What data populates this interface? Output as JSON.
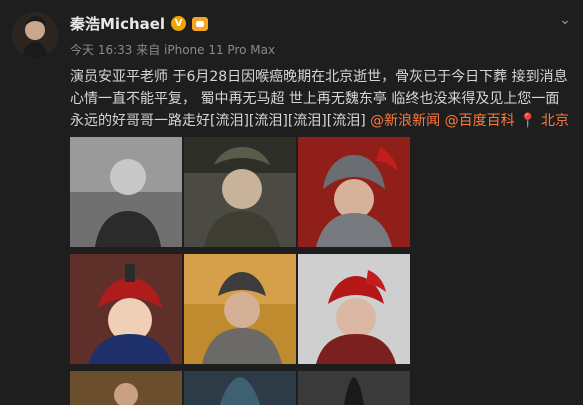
{
  "post": {
    "username": "秦浩Michael",
    "vip_badge": "V",
    "meta": "今天 16:33 来自 iPhone 11 Pro Max",
    "text_main": "演员安亚平老师 于6月28日因喉癌晚期在北京逝世，骨灰已于今日下葬 接到消息心情一直不能平复， 蜀中再无马超 世上再无魏东亭 临终也没来得及见上您一面 永远的好哥哥一路走好[流泪][流泪][流泪][流泪]",
    "link_sina": "@新浪新闻",
    "link_baike": "@百度百科",
    "location": "北京",
    "more_icon": "chevron-down-icon"
  },
  "images": [
    {
      "name": "photo-1",
      "tone": "bw"
    },
    {
      "name": "photo-2",
      "tone": "soldier"
    },
    {
      "name": "photo-3",
      "tone": "armor"
    },
    {
      "name": "photo-4",
      "tone": "qing"
    },
    {
      "name": "photo-5",
      "tone": "gold"
    },
    {
      "name": "photo-6",
      "tone": "red-helmet"
    },
    {
      "name": "photo-7",
      "tone": "dark"
    },
    {
      "name": "photo-8",
      "tone": "steel"
    },
    {
      "name": "photo-9",
      "tone": "grey"
    }
  ],
  "colors": {
    "link": "#ff7a3d",
    "background": "#1e1e1e",
    "vip": "#f0a500"
  }
}
